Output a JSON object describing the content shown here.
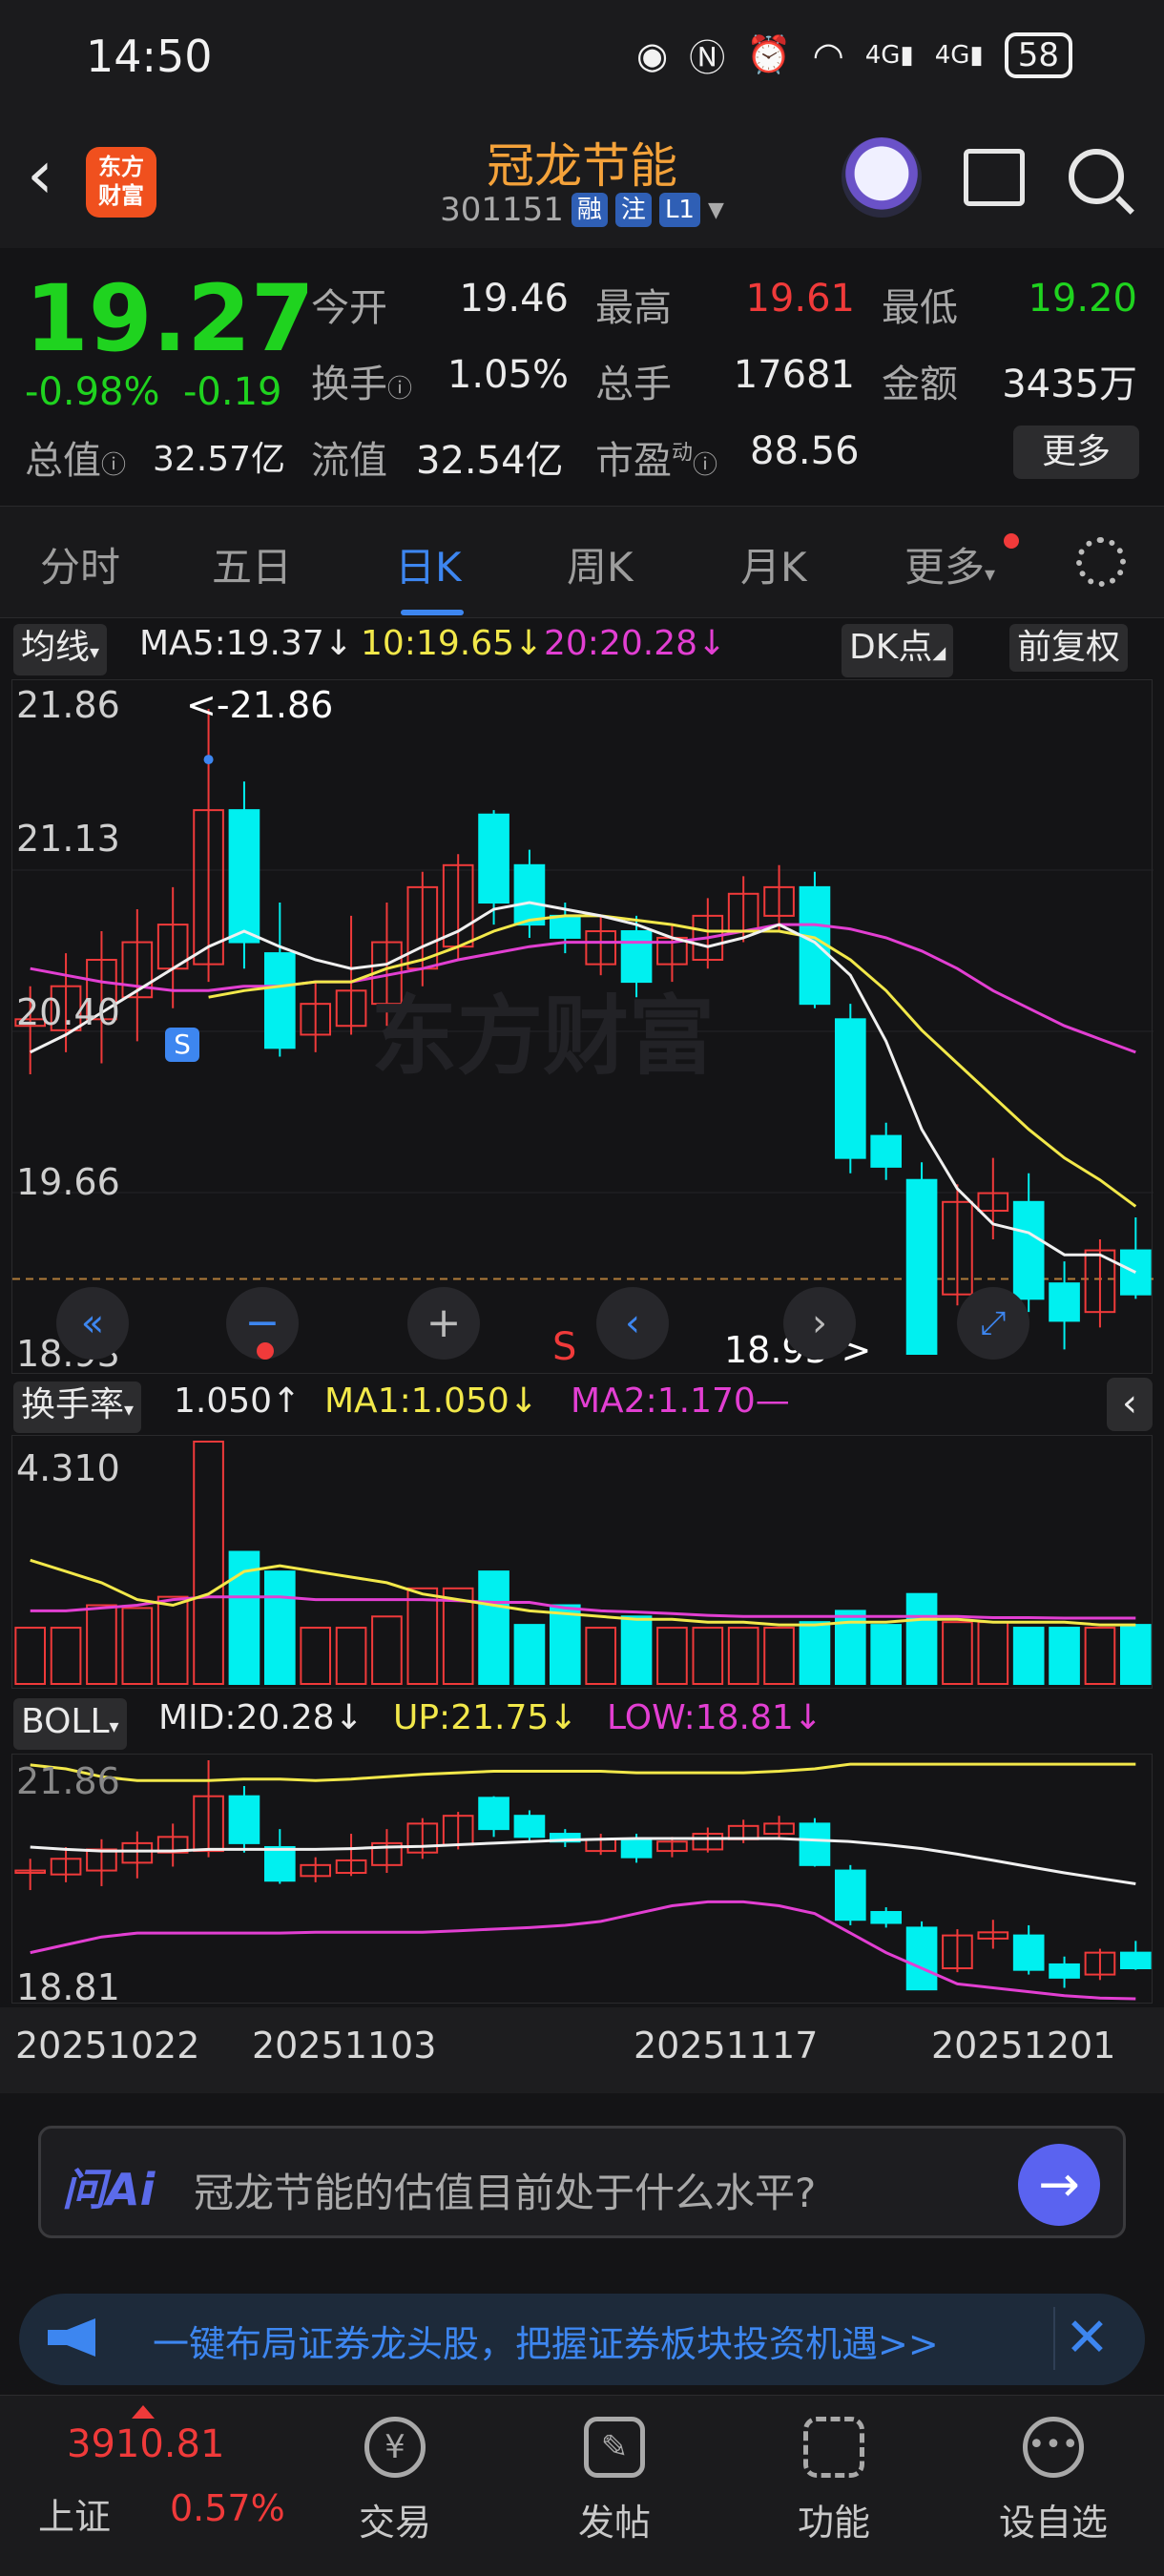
{
  "status_bar": {
    "time": "14:50",
    "icons": [
      "eye-icon",
      "nfc-icon",
      "alarm-icon",
      "wifi-icon",
      "4g-signal-icon",
      "4g-signal-icon"
    ],
    "battery": "58"
  },
  "header": {
    "logo_line1": "东方",
    "logo_line2": "财富",
    "title": "冠龙节能",
    "code": "301151",
    "tags": [
      "融",
      "注",
      "L1"
    ]
  },
  "quote": {
    "price": "19.27",
    "change_pct": "-0.98%",
    "change": "-0.19",
    "open_label": "今开",
    "open": "19.46",
    "high_label": "最高",
    "high": "19.61",
    "low_label": "最低",
    "low": "19.20",
    "turnover_label": "换手",
    "turnover": "1.05%",
    "volume_label": "总手",
    "volume": "17681",
    "amount_label": "金额",
    "amount": "3435万",
    "mktcap_label": "总值",
    "mktcap": "32.57亿",
    "float_label": "流值",
    "float": "32.54亿",
    "pe_label": "市盈",
    "pe_sup": "动",
    "pe": "88.56",
    "more": "更多"
  },
  "tabs": [
    "分时",
    "五日",
    "日K",
    "周K",
    "月K",
    "更多"
  ],
  "active_tab": "日K",
  "ma_bar": {
    "selector": "均线",
    "ma5": "MA5:19.37↓",
    "ma10": "10:19.65↓",
    "ma20": "20:20.28↓",
    "dk": "DK点",
    "adjust": "前复权"
  },
  "kline": {
    "y_labels": [
      "21.86",
      "21.13",
      "20.40",
      "19.66",
      "18.93"
    ],
    "high_note": "<-21.86",
    "low_note": "18.93->",
    "signal_s": "S",
    "signal_s2": "S",
    "watermark": "东方财富",
    "controls": [
      "double-left-icon",
      "zoom-out-icon",
      "zoom-in-icon",
      "prev-icon",
      "next-icon",
      "fullscreen-icon"
    ]
  },
  "vol_bar": {
    "selector": "换手率",
    "value": "1.050↑",
    "ma1": "MA1:1.050↓",
    "ma2": "MA2:1.170—",
    "y_label": "4.310"
  },
  "boll_bar": {
    "selector": "BOLL",
    "mid": "MID:20.28↓",
    "up": "UP:21.75↓",
    "low": "LOW:18.81↓",
    "y_top": "21.86",
    "y_bottom": "18.81"
  },
  "dates": [
    "20251022",
    "20251103",
    "20251117",
    "20251201"
  ],
  "ai": {
    "logo": "问Ai",
    "question": "冠龙节能的估值目前处于什么水平?"
  },
  "promo": {
    "text": "一键布局证券龙头股，把握证券板块投资机遇>>"
  },
  "nav": {
    "index_value": "3910.81",
    "index_name": "上证",
    "index_pct": "0.57%",
    "items": [
      "交易",
      "发帖",
      "功能",
      "设自选"
    ]
  },
  "chart_data": {
    "type": "candlestick",
    "ylim": [
      18.93,
      21.86
    ],
    "candles": [
      {
        "o": 20.42,
        "c": 20.45,
        "h": 20.6,
        "l": 20.2
      },
      {
        "o": 20.4,
        "c": 20.6,
        "h": 20.75,
        "l": 20.3
      },
      {
        "o": 20.45,
        "c": 20.72,
        "h": 20.85,
        "l": 20.25
      },
      {
        "o": 20.55,
        "c": 20.8,
        "h": 20.95,
        "l": 20.35
      },
      {
        "o": 20.68,
        "c": 20.88,
        "h": 21.05,
        "l": 20.5
      },
      {
        "o": 20.7,
        "c": 21.4,
        "h": 21.86,
        "l": 20.62
      },
      {
        "o": 21.4,
        "c": 20.8,
        "h": 21.53,
        "l": 20.68
      },
      {
        "o": 20.75,
        "c": 20.32,
        "h": 20.98,
        "l": 20.28
      },
      {
        "o": 20.38,
        "c": 20.52,
        "h": 20.62,
        "l": 20.3
      },
      {
        "o": 20.42,
        "c": 20.58,
        "h": 20.92,
        "l": 20.38
      },
      {
        "o": 20.52,
        "c": 20.8,
        "h": 20.98,
        "l": 20.42
      },
      {
        "o": 20.68,
        "c": 21.05,
        "h": 21.12,
        "l": 20.6
      },
      {
        "o": 20.78,
        "c": 21.15,
        "h": 21.2,
        "l": 20.72
      },
      {
        "o": 21.38,
        "c": 20.98,
        "h": 21.4,
        "l": 20.88
      },
      {
        "o": 21.15,
        "c": 20.88,
        "h": 21.22,
        "l": 20.82
      },
      {
        "o": 20.92,
        "c": 20.82,
        "h": 20.98,
        "l": 20.75
      },
      {
        "o": 20.7,
        "c": 20.85,
        "h": 20.92,
        "l": 20.65
      },
      {
        "o": 20.85,
        "c": 20.62,
        "h": 20.92,
        "l": 20.55
      },
      {
        "o": 20.7,
        "c": 20.82,
        "h": 20.88,
        "l": 20.62
      },
      {
        "o": 20.72,
        "c": 20.92,
        "h": 21.0,
        "l": 20.68
      },
      {
        "o": 20.85,
        "c": 21.02,
        "h": 21.1,
        "l": 20.8
      },
      {
        "o": 20.92,
        "c": 21.05,
        "h": 21.15,
        "l": 20.85
      },
      {
        "o": 21.05,
        "c": 20.52,
        "h": 21.12,
        "l": 20.5
      },
      {
        "o": 20.45,
        "c": 19.82,
        "h": 20.52,
        "l": 19.75
      },
      {
        "o": 19.92,
        "c": 19.78,
        "h": 19.98,
        "l": 19.72
      },
      {
        "o": 19.72,
        "c": 18.93,
        "h": 19.8,
        "l": 18.93
      },
      {
        "o": 19.2,
        "c": 19.62,
        "h": 19.7,
        "l": 19.15
      },
      {
        "o": 19.58,
        "c": 19.66,
        "h": 19.82,
        "l": 19.45
      },
      {
        "o": 19.62,
        "c": 19.18,
        "h": 19.75,
        "l": 19.12
      },
      {
        "o": 19.25,
        "c": 19.08,
        "h": 19.35,
        "l": 18.95
      },
      {
        "o": 19.12,
        "c": 19.4,
        "h": 19.45,
        "l": 19.05
      },
      {
        "o": 19.4,
        "c": 19.2,
        "h": 19.55,
        "l": 19.18
      }
    ],
    "ma5": [
      20.3,
      20.38,
      20.48,
      20.58,
      20.68,
      20.78,
      20.85,
      20.78,
      20.72,
      20.68,
      20.7,
      20.78,
      20.85,
      20.95,
      20.98,
      20.95,
      20.92,
      20.88,
      20.82,
      20.78,
      20.82,
      20.88,
      20.8,
      20.65,
      20.35,
      19.95,
      19.68,
      19.52,
      19.48,
      19.38,
      19.38,
      19.3
    ],
    "ma10": [
      null,
      null,
      null,
      null,
      null,
      20.55,
      20.58,
      20.6,
      20.62,
      20.62,
      20.68,
      20.72,
      20.78,
      20.85,
      20.9,
      20.92,
      20.92,
      20.9,
      20.88,
      20.85,
      20.85,
      20.85,
      20.82,
      20.72,
      20.58,
      20.4,
      20.25,
      20.1,
      19.95,
      19.82,
      19.72,
      19.6
    ],
    "ma20": [
      20.68,
      20.65,
      20.62,
      20.6,
      20.58,
      20.58,
      20.6,
      20.6,
      20.62,
      20.62,
      20.65,
      20.68,
      20.72,
      20.75,
      20.78,
      20.8,
      20.8,
      20.8,
      20.8,
      20.82,
      20.85,
      20.88,
      20.88,
      20.86,
      20.82,
      20.76,
      20.68,
      20.58,
      20.5,
      20.42,
      20.36,
      20.3
    ],
    "turnover": [
      1.0,
      1.0,
      1.4,
      1.35,
      1.55,
      4.31,
      2.35,
      2.0,
      1.0,
      1.0,
      1.2,
      1.7,
      1.7,
      2.0,
      1.05,
      1.4,
      1.0,
      1.2,
      1.0,
      1.0,
      1.0,
      1.0,
      1.1,
      1.3,
      1.05,
      1.6,
      1.1,
      1.1,
      1.0,
      1.0,
      1.0,
      1.05
    ],
    "turnover_ma1": [
      2.2,
      2.0,
      1.8,
      1.5,
      1.4,
      1.6,
      2.0,
      2.1,
      2.0,
      1.9,
      1.8,
      1.6,
      1.5,
      1.4,
      1.3,
      1.25,
      1.2,
      1.15,
      1.15,
      1.1,
      1.1,
      1.05,
      1.05,
      1.1,
      1.1,
      1.15,
      1.15,
      1.1,
      1.1,
      1.1,
      1.05,
      1.05
    ],
    "turnover_ma2": [
      1.3,
      1.3,
      1.35,
      1.4,
      1.5,
      1.55,
      1.55,
      1.55,
      1.5,
      1.5,
      1.5,
      1.5,
      1.48,
      1.45,
      1.45,
      1.35,
      1.3,
      1.28,
      1.25,
      1.22,
      1.2,
      1.2,
      1.2,
      1.2,
      1.2,
      1.2,
      1.2,
      1.18,
      1.18,
      1.17,
      1.17,
      1.17
    ],
    "boll_up": [
      21.8,
      21.75,
      21.65,
      21.6,
      21.6,
      21.6,
      21.62,
      21.62,
      21.6,
      21.62,
      21.65,
      21.68,
      21.7,
      21.72,
      21.72,
      21.72,
      21.72,
      21.7,
      21.7,
      21.7,
      21.7,
      21.72,
      21.75,
      21.9,
      22.05,
      22.08,
      22.08,
      22.12,
      22.15,
      22.16,
      22.16,
      22.15
    ],
    "boll_mid": [
      20.75,
      20.72,
      20.7,
      20.7,
      20.7,
      20.72,
      20.72,
      20.72,
      20.72,
      20.73,
      20.75,
      20.76,
      20.78,
      20.8,
      20.82,
      20.84,
      20.85,
      20.86,
      20.86,
      20.86,
      20.86,
      20.86,
      20.84,
      20.82,
      20.78,
      20.73,
      20.66,
      20.58,
      20.5,
      20.42,
      20.35,
      20.28
    ],
    "boll_low": [
      19.4,
      19.5,
      19.6,
      19.65,
      19.65,
      19.65,
      19.65,
      19.65,
      19.66,
      19.66,
      19.66,
      19.66,
      19.68,
      19.7,
      19.72,
      19.75,
      19.8,
      19.9,
      20.0,
      20.05,
      20.05,
      20.0,
      19.9,
      19.65,
      19.4,
      19.2,
      19.0,
      18.95,
      18.9,
      18.85,
      18.82,
      18.81
    ],
    "boll_ylim": [
      18.81,
      21.86
    ]
  }
}
